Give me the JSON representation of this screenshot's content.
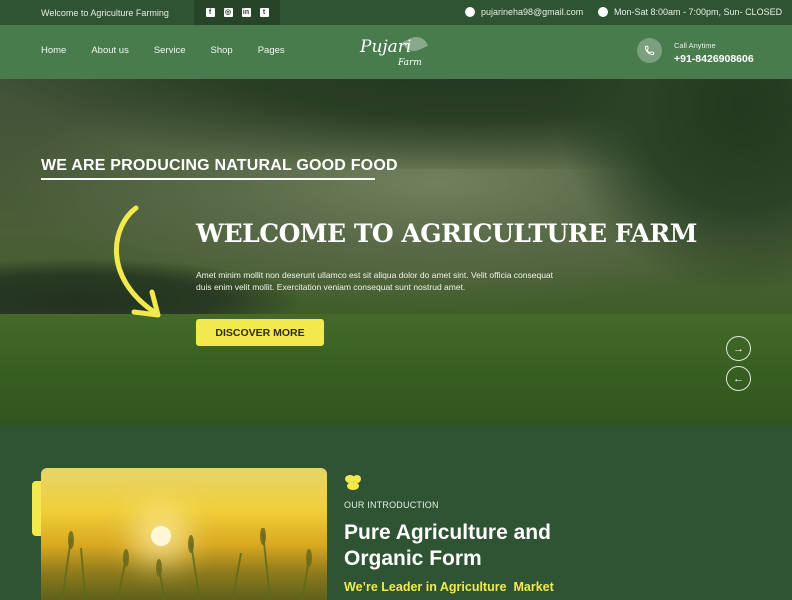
{
  "topbar": {
    "welcome": "Welcome to Agriculture Farming",
    "social": [
      {
        "icon": "facebook-icon",
        "glyph": "f"
      },
      {
        "icon": "instagram-icon",
        "glyph": "◎"
      },
      {
        "icon": "linkedin-icon",
        "glyph": "in"
      },
      {
        "icon": "twitter-icon",
        "glyph": "t"
      }
    ],
    "email": "pujarineha98@gmail.com",
    "hours": "Mon-Sat 8:00am - 7:00pm, Sun- CLOSED"
  },
  "nav": {
    "items": [
      "Home",
      "About us",
      "Service",
      "Shop",
      "Pages"
    ],
    "logo_main": "Pujari",
    "logo_sub": "Farm",
    "call_label": "Call Anytime",
    "call_number": "+91-8426908606"
  },
  "hero": {
    "tagline": "WE ARE PRODUCING NATURAL GOOD FOOD",
    "headline": "WELCOME TO AGRICULTURE FARM",
    "description": "Amet minim mollit non deserunt ullamco est sit aliqua dolor do amet sint. Velit officia consequat duis enim velit mollit. Exercitation veniam consequat sunt nostrud amet.",
    "cta": "DISCOVER MORE",
    "next_glyph": "→",
    "prev_glyph": "←"
  },
  "intro": {
    "kicker": "OUR INTRODUCTION",
    "title": "Pure Agriculture and Organic Form",
    "subtitle": "We’re Leader in Agriculture  Market"
  },
  "colors": {
    "dark_green": "#2f5433",
    "nav_green": "#497c4d",
    "accent_yellow": "#f2e94e"
  }
}
